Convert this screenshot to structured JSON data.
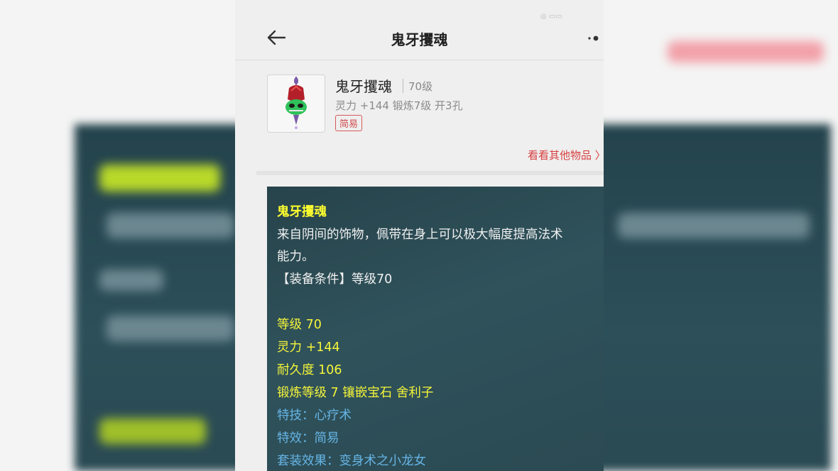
{
  "header": {
    "title": "鬼牙攫魂"
  },
  "item": {
    "name": "鬼牙攫魂",
    "level": "70级",
    "stats": "灵力 +144 锻炼7级 开3孔",
    "tag": "简易"
  },
  "links": {
    "other_items": "看看其他物品 〉"
  },
  "description": {
    "title": "鬼牙攫魂",
    "text_line1": "来自阴间的饰物，佩带在身上可以极大幅度提高法术",
    "text_line2": "能力。",
    "requirement": "【装备条件】等级70",
    "level": "等级 70",
    "spirit": "灵力 +144",
    "durability": "耐久度 106",
    "forge": "锻炼等级 7 镶嵌宝石 舍利子",
    "skill": "特技：心疗术",
    "effect": "特效：简易",
    "set_effect": "套装效果：变身术之小龙女"
  },
  "colors": {
    "accent_red": "#d84040",
    "panel_bg": "#2b4a53",
    "stat_yellow": "#f5f53a",
    "special_blue": "#66b5e6"
  },
  "icons": [
    "back-arrow-icon",
    "more-dots-icon",
    "item-pendant-icon"
  ]
}
